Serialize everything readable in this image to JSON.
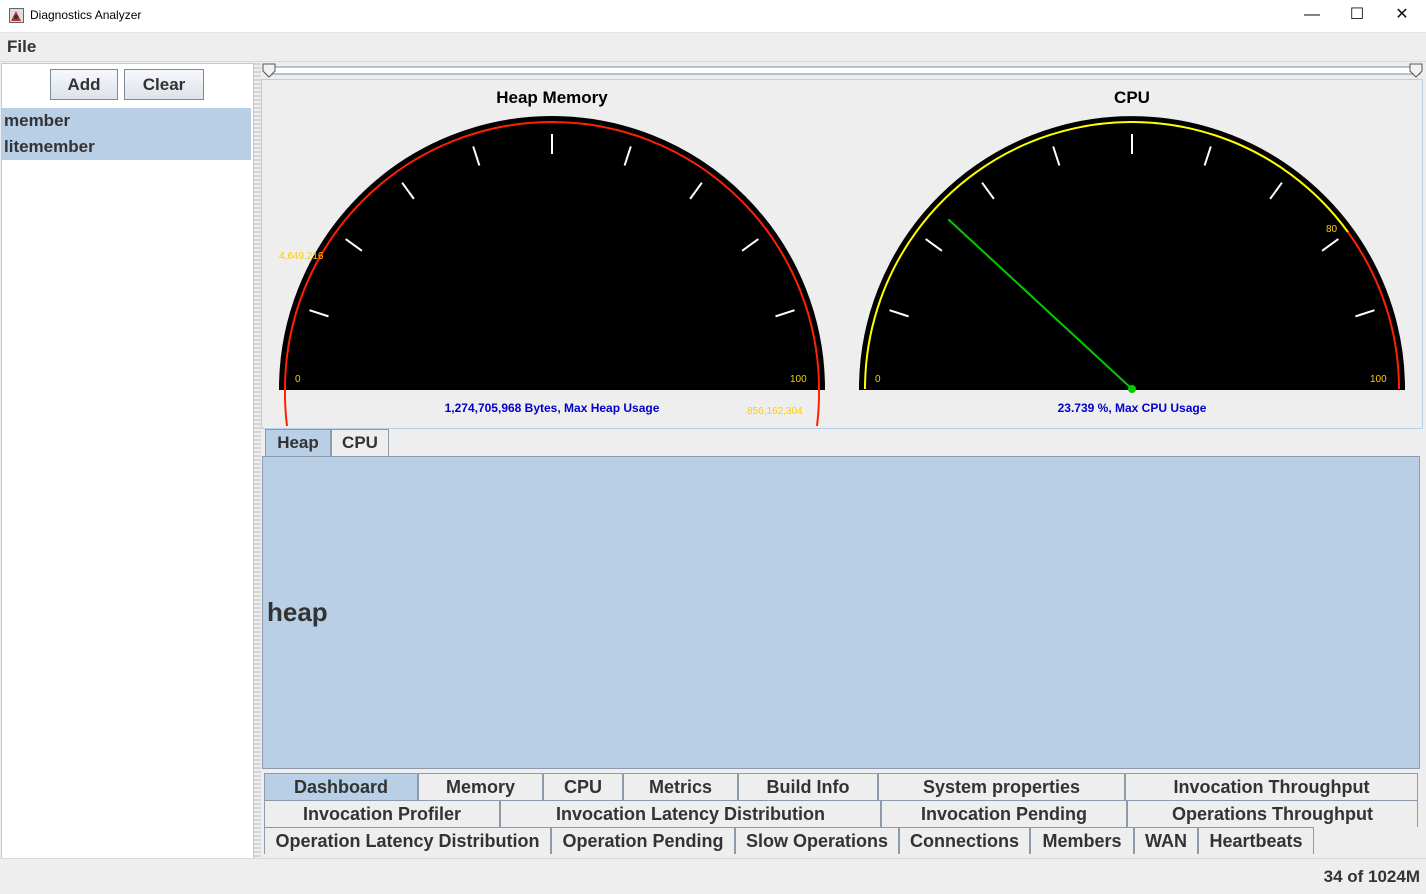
{
  "window": {
    "title": "Diagnostics Analyzer"
  },
  "menu": {
    "file": "File"
  },
  "sidebar": {
    "add_label": "Add",
    "clear_label": "Clear",
    "items": [
      {
        "label": "member"
      },
      {
        "label": "litemember"
      }
    ]
  },
  "gauges": {
    "heap": {
      "title": "Heap Memory",
      "scale_min_label": "0",
      "scale_max_label": "100",
      "threshold_label": "4,649,216",
      "max_value_label": "856,162,304",
      "readout": "1,274,705,968 Bytes, Max Heap Usage",
      "arc_color": "#ff2200"
    },
    "cpu": {
      "title": "CPU",
      "scale_min_label": "0",
      "scale_max_label": "100",
      "threshold_label": "80",
      "readout": "23.739 %, Max CPU Usage",
      "value_percent": 23.739,
      "arc_color": "#ffff00",
      "danger_color": "#ff2200",
      "needle_color": "#00cc00"
    }
  },
  "inner_tabs": [
    {
      "label": "Heap",
      "active": true
    },
    {
      "label": "CPU",
      "active": false
    }
  ],
  "content": {
    "label": "heap"
  },
  "bottom_tabs": [
    [
      "Dashboard",
      "Memory",
      "CPU",
      "Metrics",
      "Build Info",
      "System properties",
      "Invocation Throughput"
    ],
    [
      "Invocation Profiler",
      "Invocation Latency Distribution",
      "Invocation Pending",
      "Operations Throughput"
    ],
    [
      "Operation Latency Distribution",
      "Operation Pending",
      "Slow Operations",
      "Connections",
      "Members",
      "WAN",
      "Heartbeats"
    ]
  ],
  "active_bottom_tab": "Dashboard",
  "status": {
    "memory": "34 of 1024M"
  },
  "colors": {
    "selection": "#b8cfe5",
    "readout_text": "#0000cc",
    "scale_label": "#ffcc00"
  }
}
